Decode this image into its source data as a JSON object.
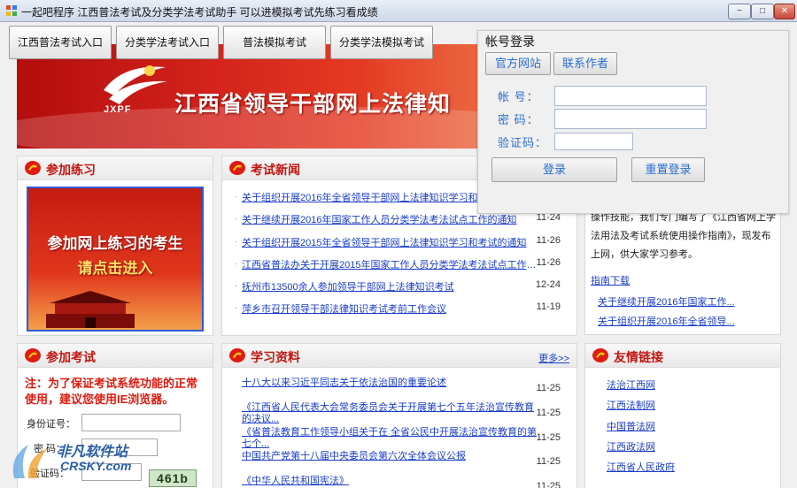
{
  "window": {
    "title": "一起吧程序 江西普法考试及分类学法考试助手 可以进模拟考试先练习看成绩",
    "minimize": "−",
    "maximize": "□",
    "close": "✕"
  },
  "toolbar": {
    "buttons": [
      "江西普法考试入口",
      "分类学法考试入口",
      "普法模拟考试",
      "分类学法模拟考试"
    ]
  },
  "banner": {
    "logo_text": "JXPF",
    "site_title": "江西省领导干部网上法律知"
  },
  "practice": {
    "title": "参加练习",
    "image_line1": "参加网上练习的考生",
    "image_line2": "请点击进入"
  },
  "news": {
    "title": "考试新闻",
    "items": [
      {
        "title": "关于组织开展2016年全省领导干部网上法律知识学习和考试的通知",
        "date": "11-24"
      },
      {
        "title": "关于继续开展2016年国家工作人员分类学法考法试点工作的通知",
        "date": "11-24"
      },
      {
        "title": "关于组织开展2015年全省领导干部网上法律知识学习和考试的通知",
        "date": "11-26"
      },
      {
        "title": "江西省普法办关于开展2015年国家工作人员分类学法考法试点工作的通...",
        "date": "11-26"
      },
      {
        "title": "抚州市13500余人参加领导干部网上法律知识考试",
        "date": "12-24"
      },
      {
        "title": "萍乡市召开领导干部法律知识考试考前工作会议",
        "date": "11-19"
      }
    ]
  },
  "intro": {
    "text": "干部网上法律知识学习和考试系统的使用和操作技能，我们专门编写了《江西省网上学法用法及考试系统使用操作指南》，现发布上网，供大家学习参考。",
    "guide_link": "指南下载",
    "links": [
      "关于继续开展2016年国家工作...",
      "关于组织开展2016年全省领导..."
    ]
  },
  "exam": {
    "title": "参加考试",
    "notice": "注：为了保证考试系统功能的正常使用，建议您使用IE浏览器。",
    "id_label": "身份证号：",
    "password_label": "密  码：",
    "captcha_label": "验证码：",
    "captcha_value": "461b"
  },
  "study": {
    "title": "学习资料",
    "more": "更多>>",
    "items": [
      {
        "title": "十八大以来习近平同志关于依法治国的重要论述",
        "date": "11-25"
      },
      {
        "title": "《江西省人民代表大会常务委员会关于开展第七个五年法治宣传教育的决议...",
        "date": "11-25"
      },
      {
        "title": "《省普法教育工作领导小组关于在 全省公民中开展法治宣传教育的第七个...",
        "date": "11-25"
      },
      {
        "title": "中国共产党第十八届中央委员会第六次全体会议公报",
        "date": "11-25"
      },
      {
        "title": "《中华人民共和国宪法》",
        "date": "11-25"
      }
    ]
  },
  "friends": {
    "title": "友情链接",
    "items": [
      "法治江西网",
      "江西法制网",
      "中国普法网",
      "江西政法网",
      "江西省人民政府"
    ]
  },
  "login": {
    "title": "帐号登录",
    "official_site": "官方网站",
    "contact_author": "联系作者",
    "account_label": "帐  号：",
    "password_label": "密  码：",
    "captcha_label": "验证码：",
    "login_button": "登录",
    "reset_button": "重置登录"
  },
  "watermark": {
    "cn": "非凡软件站",
    "en": "CRSKY.com"
  },
  "colors": {
    "accent_red": "#c0160f",
    "link_blue": "#1a3ec8",
    "login_text_blue": "#2a6fd0"
  }
}
